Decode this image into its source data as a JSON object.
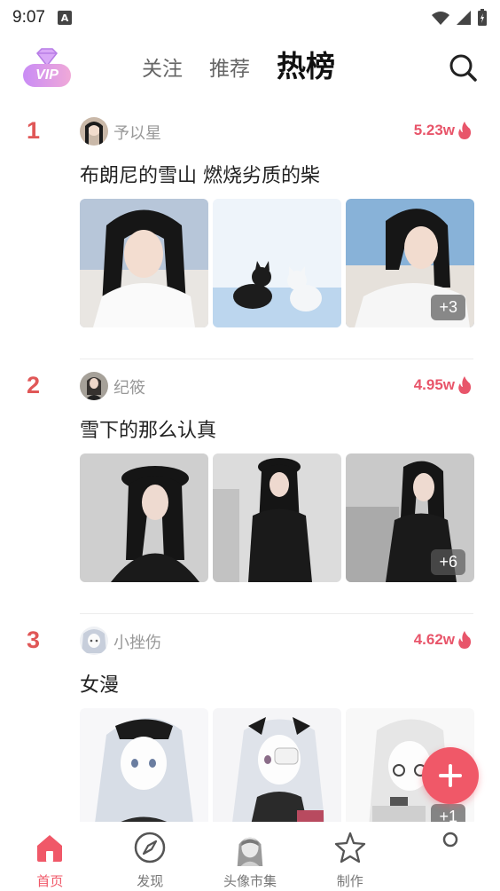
{
  "status_bar": {
    "time": "9:07",
    "notification_letter": "A"
  },
  "top_nav": {
    "vip_label": "VIP",
    "tabs": [
      {
        "label": "关注",
        "active": false
      },
      {
        "label": "推荐",
        "active": false
      },
      {
        "label": "热榜",
        "active": true
      }
    ],
    "search_icon": "search-icon"
  },
  "feed": [
    {
      "rank": "1",
      "user": "予以星",
      "hot": "5.23w",
      "title": "布朗尼的雪山 燃烧劣质的柴",
      "more": "+3"
    },
    {
      "rank": "2",
      "user": "纪筱",
      "hot": "4.95w",
      "title": "雪下的那么认真",
      "more": "+6"
    },
    {
      "rank": "3",
      "user": "小挫伤",
      "hot": "4.62w",
      "title": "女漫",
      "more": "+1"
    }
  ],
  "fab": {
    "icon": "plus-icon"
  },
  "bottom_nav": [
    {
      "label": "首页",
      "icon": "home-icon",
      "active": true
    },
    {
      "label": "发现",
      "icon": "compass-icon",
      "active": false
    },
    {
      "label": "头像市集",
      "icon": "avatar-market-icon",
      "active": false
    },
    {
      "label": "制作",
      "icon": "star-icon",
      "active": false
    },
    {
      "label": "",
      "icon": "profile-icon",
      "active": false
    }
  ],
  "colors": {
    "accent": "#f05868",
    "rank": "#e05757",
    "hot": "#e8556a"
  }
}
